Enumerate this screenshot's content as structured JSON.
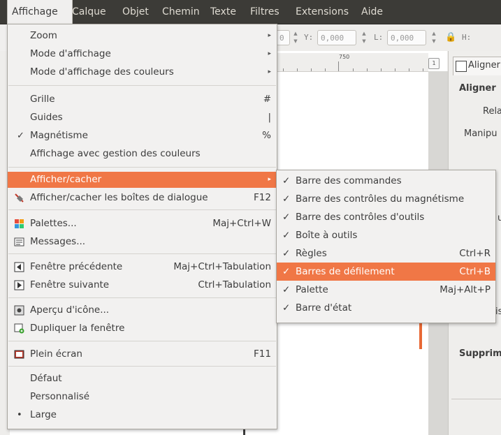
{
  "menubar": {
    "items": [
      "Affichage",
      "Calque",
      "Objet",
      "Chemin",
      "Texte",
      "Filtres",
      "Extensions",
      "Aide"
    ]
  },
  "toolbar": {
    "x_value": "0",
    "y_label": "Y:",
    "y_value": "0,000",
    "w_label": "L:",
    "w_value": "0,000",
    "h_label": "H:"
  },
  "ruler": {
    "label": "750"
  },
  "ruler_button": "1",
  "dock": {
    "tab_label": "Aligner",
    "aligner_heading": "Aligner",
    "relative_label": "Rela",
    "manipulate_label": "Manipu",
    "partial1": "u",
    "partial2": "is",
    "delete_label": "Supprim"
  },
  "menu": {
    "items": [
      {
        "label": "Zoom",
        "arrow": "▸"
      },
      {
        "label": "Mode d'affichage",
        "arrow": "▸"
      },
      {
        "label": "Mode d'affichage des couleurs",
        "arrow": "▸"
      },
      {
        "label": "Grille",
        "shortcut": "#"
      },
      {
        "label": "Guides",
        "shortcut": "|"
      },
      {
        "label": "Magnétisme",
        "shortcut": "%",
        "check": "✓"
      },
      {
        "label": "Affichage avec gestion des couleurs"
      },
      {
        "label": "Afficher/cacher",
        "arrow": "▸"
      },
      {
        "label": "Afficher/cacher les boîtes de dialogue",
        "shortcut": "F12"
      },
      {
        "label": "Palettes...",
        "shortcut": "Maj+Ctrl+W"
      },
      {
        "label": "Messages..."
      },
      {
        "label": "Fenêtre précédente",
        "shortcut": "Maj+Ctrl+Tabulation"
      },
      {
        "label": "Fenêtre suivante",
        "shortcut": "Ctrl+Tabulation"
      },
      {
        "label": "Aperçu d'icône..."
      },
      {
        "label": "Dupliquer la fenêtre"
      },
      {
        "label": "Plein écran",
        "shortcut": "F11"
      },
      {
        "label": "Défaut"
      },
      {
        "label": "Personnalisé"
      },
      {
        "label": "Large",
        "check": "•"
      }
    ]
  },
  "submenu": {
    "items": [
      {
        "label": "Barre des commandes",
        "check": "✓"
      },
      {
        "label": "Barre des contrôles du magnétisme",
        "check": "✓"
      },
      {
        "label": "Barre des contrôles d'outils",
        "check": "✓"
      },
      {
        "label": "Boîte à outils",
        "check": "✓"
      },
      {
        "label": "Règles",
        "check": "✓",
        "shortcut": "Ctrl+R"
      },
      {
        "label": "Barres de défilement",
        "check": "✓",
        "shortcut": "Ctrl+B"
      },
      {
        "label": "Palette",
        "check": "✓",
        "shortcut": "Maj+Alt+P"
      },
      {
        "label": "Barre d'état",
        "check": "✓"
      }
    ]
  }
}
